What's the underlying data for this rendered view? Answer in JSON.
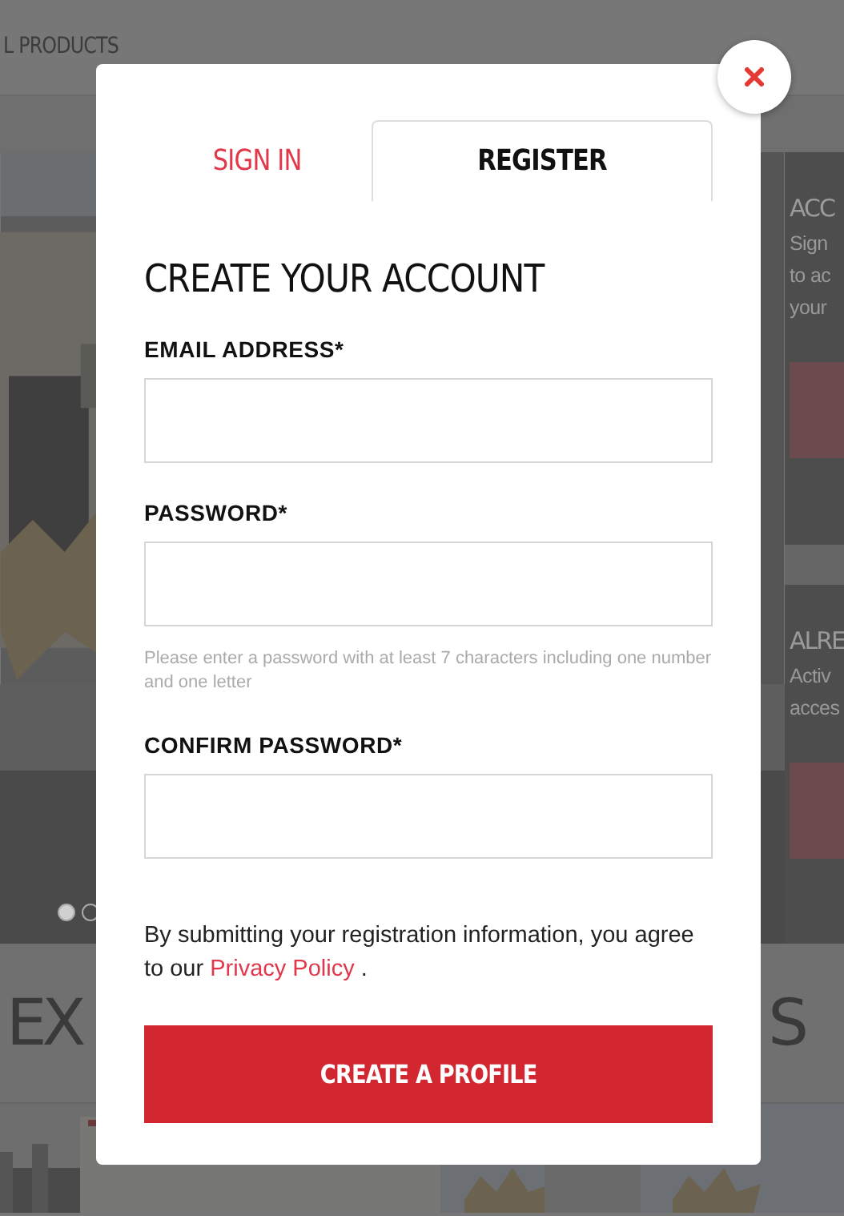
{
  "background": {
    "nav_item": "L PRODUCTS",
    "panels": [
      {
        "title": "ACC",
        "lines": [
          "Sign",
          "to ac",
          "your"
        ]
      },
      {
        "title": "ALRE",
        "lines": [
          "Activ",
          "acces"
        ]
      }
    ],
    "carousel": [
      {
        "selected": true
      },
      {
        "selected": false
      }
    ],
    "section_title_left": "EX",
    "section_title_right": "S"
  },
  "modal": {
    "tabs": [
      {
        "label": "SIGN IN",
        "selected": false
      },
      {
        "label": "REGISTER",
        "selected": true
      }
    ],
    "heading": "CREATE YOUR ACCOUNT",
    "fields": [
      {
        "label": "EMAIL ADDRESS*"
      },
      {
        "label": "PASSWORD*",
        "help": "Please enter a password with at least 7 characters including one number and one letter"
      },
      {
        "label": "CONFIRM PASSWORD*"
      }
    ],
    "notice": "By submitting your registration information, you agree to our",
    "notice_link": "Privacy Policy",
    "notice_end": ".",
    "submit": "CREATE A PROFILE"
  }
}
